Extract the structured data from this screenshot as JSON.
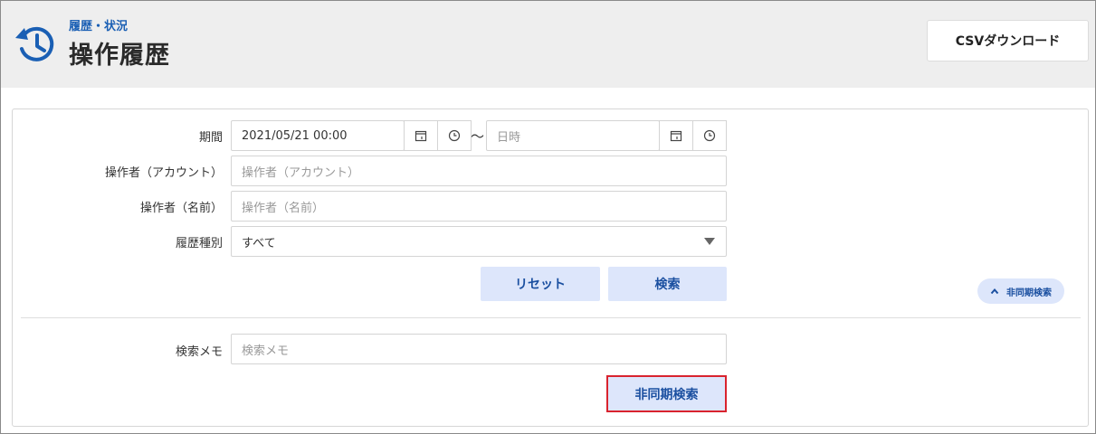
{
  "header": {
    "breadcrumb": "履歴・状況",
    "title": "操作履歴",
    "csv_label": "CSVダウンロード",
    "icon": "history-icon",
    "accent_color": "#1a5fb4"
  },
  "form": {
    "period": {
      "label": "期間",
      "start_value": "2021/05/21 00:00",
      "separator": "～",
      "end_placeholder": "日時",
      "calendar_icon": "calendar-icon",
      "clock_icon": "clock-icon"
    },
    "account": {
      "label": "操作者（アカウント）",
      "placeholder": "操作者（アカウント）"
    },
    "name": {
      "label": "操作者（名前）",
      "placeholder": "操作者（名前）"
    },
    "type": {
      "label": "履歴種別",
      "selected": "すべて"
    },
    "reset_label": "リセット",
    "search_label": "検索",
    "async_toggle_label": "非同期検索",
    "memo": {
      "label": "検索メモ",
      "placeholder": "検索メモ"
    },
    "async_search_label": "非同期検索"
  }
}
